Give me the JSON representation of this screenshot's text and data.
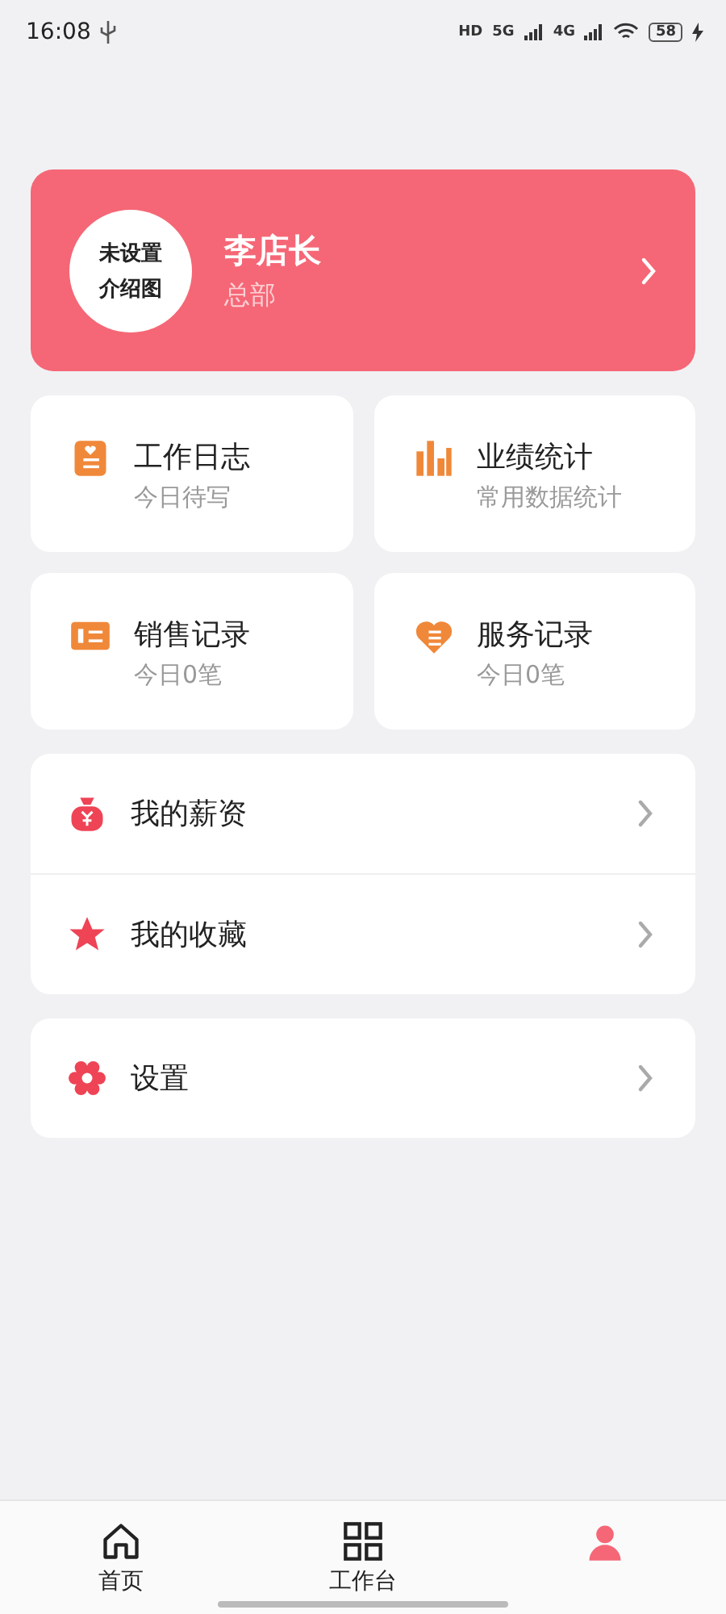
{
  "status_bar": {
    "time": "16:08",
    "hd": "HD",
    "sim_1": "5G",
    "sim_2": "4G",
    "battery": "58"
  },
  "profile": {
    "avatar_lines": [
      "未设置",
      "介绍图"
    ],
    "name": "李店长",
    "branch": "总部"
  },
  "tiles": [
    {
      "kind": "journal",
      "title": "工作日志",
      "subtitle": "今日待写"
    },
    {
      "kind": "stats",
      "title": "业绩统计",
      "subtitle": "常用数据统计"
    },
    {
      "kind": "sales",
      "title": "销售记录",
      "subtitle": "今日0笔"
    },
    {
      "kind": "service",
      "title": "服务记录",
      "subtitle": "今日0笔"
    }
  ],
  "menu_groups": [
    [
      {
        "kind": "salary",
        "label": "我的薪资"
      },
      {
        "kind": "favorites",
        "label": "我的收藏"
      }
    ],
    [
      {
        "kind": "settings",
        "label": "设置"
      }
    ]
  ],
  "tab_bar": [
    {
      "kind": "home",
      "label": "首页",
      "selected": false
    },
    {
      "kind": "workbench",
      "label": "工作台",
      "selected": false
    },
    {
      "kind": "profile",
      "selected": true
    }
  ]
}
